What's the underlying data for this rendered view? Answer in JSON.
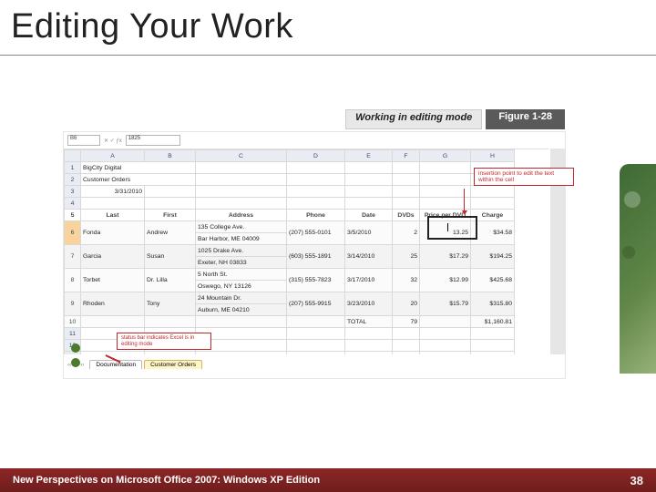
{
  "slide": {
    "title": "Editing Your Work"
  },
  "figure": {
    "banner_label": "Working in editing mode",
    "banner_num": "Figure 1-28"
  },
  "excel": {
    "namebox_ref": "B6",
    "formula_bar": "1825",
    "columns": [
      "A",
      "B",
      "C",
      "D",
      "E",
      "F",
      "G",
      "H"
    ],
    "headers": {
      "a": "Last",
      "b": "First",
      "c": "Address",
      "d": "Phone",
      "e": "Date",
      "f": "DVDs",
      "g": "Price per DVD",
      "h": "Charge"
    },
    "top": {
      "company": "BigCity Digital",
      "line2": "Customer Orders",
      "date": "3/31/2010"
    },
    "rows": [
      {
        "n": 6,
        "last": "Fonda",
        "first": "Andrew",
        "addr1": "135 College Ave.",
        "addr2": "Bar Harbor, ME 04009",
        "phone": "(207) 555-0101",
        "date": "3/5/2010",
        "dvds": 2,
        "price": "13.25",
        "charge": "$34.58"
      },
      {
        "n": 7,
        "last": "Garcia",
        "first": "Susan",
        "addr1": "1025 Drake Ave.",
        "addr2": "Exeter, NH 03833",
        "phone": "(603) 555-1891",
        "date": "3/14/2010",
        "dvds": 25,
        "price": "$17.29",
        "charge": "$194.25"
      },
      {
        "n": 8,
        "last": "Torbet",
        "first": "Dr. Lilla",
        "addr1": "5 North St.",
        "addr2": "Oswego, NY 13126",
        "phone": "(315) 555-7823",
        "date": "3/17/2010",
        "dvds": 32,
        "price": "$12.99",
        "charge": "$425.68"
      },
      {
        "n": 9,
        "last": "Rhoden",
        "first": "Tony",
        "addr1": "24 Mountain Dr.",
        "addr2": "Auburn, ME 04210",
        "phone": "(207) 555-9915",
        "date": "3/23/2010",
        "dvds": 20,
        "price": "$15.79",
        "charge": "$315.80"
      }
    ],
    "totals": {
      "label": "TOTAL",
      "dvds": 79,
      "charge": "$1,160.81"
    },
    "tabs": {
      "sheet1": "Documentation",
      "sheet2": "Customer Orders"
    },
    "nav": "‹‹  ‹  ›  ››"
  },
  "callouts": {
    "insertion": "insertion point to edit the text within the cell",
    "statusbar": "status bar indicates Excel is in editing mode"
  },
  "footer": {
    "caption": "New Perspectives on Microsoft Office 2007: Windows XP Edition",
    "page": "38"
  },
  "colors": {
    "accent": "#c1272d",
    "footer_bar": "#8c2626",
    "decor_green": "#3f6b24"
  }
}
